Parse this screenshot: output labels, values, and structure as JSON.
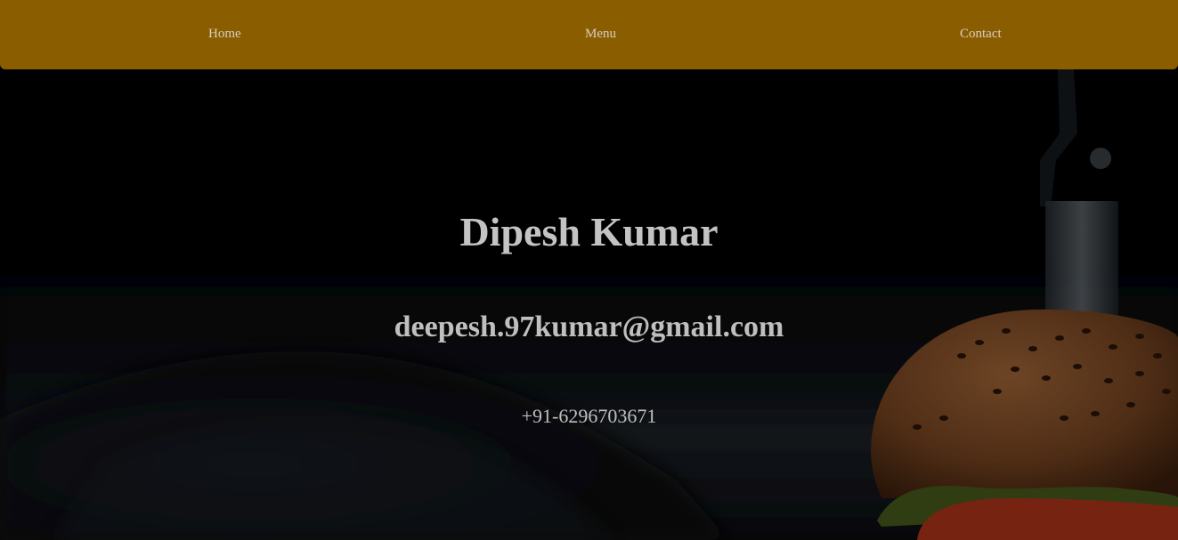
{
  "nav": {
    "home_label": "Home",
    "menu_label": "Menu",
    "contact_label": "Contact",
    "background_color": "#8a5e00"
  },
  "contact": {
    "name": "Dipesh Kumar",
    "email": "deepesh.97kumar@gmail.com",
    "phone": "+91-6296703671"
  },
  "hero": {
    "image_icon": "burger-photo-icon"
  }
}
